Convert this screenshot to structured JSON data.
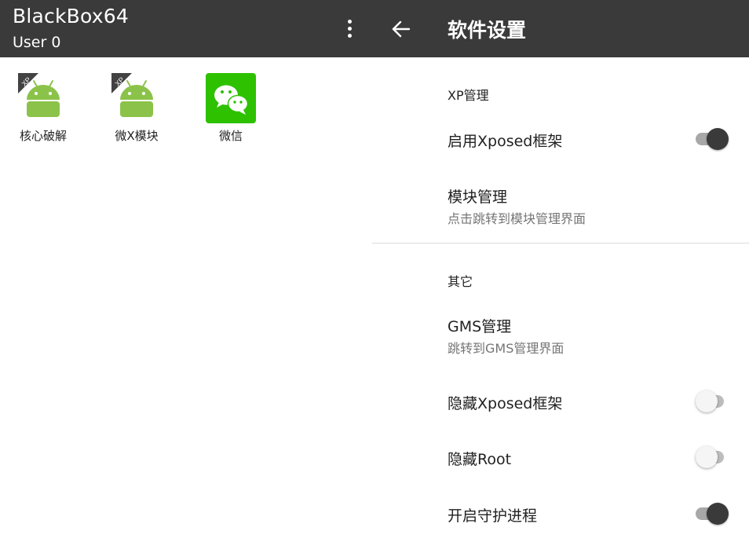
{
  "left": {
    "app_title": "BlackBox64",
    "user_label": "User 0",
    "apps": [
      {
        "label": "核心破解",
        "icon": "android-xp-icon",
        "badge": "XP"
      },
      {
        "label": "微X模块",
        "icon": "android-xp-icon",
        "badge": "XP"
      },
      {
        "label": "微信",
        "icon": "wechat-icon"
      }
    ]
  },
  "right": {
    "title": "软件设置",
    "categories": {
      "xp": "XP管理",
      "other": "其它"
    },
    "prefs": {
      "enable_xposed": {
        "title": "启用Xposed框架",
        "checked": true
      },
      "module_manage": {
        "title": "模块管理",
        "summary": "点击跳转到模块管理界面"
      },
      "gms_manage": {
        "title": "GMS管理",
        "summary": "跳转到GMS管理界面"
      },
      "hide_xposed": {
        "title": "隐藏Xposed框架",
        "checked": false
      },
      "hide_root": {
        "title": "隐藏Root",
        "checked": false
      },
      "daemon": {
        "title": "开启守护进程",
        "checked": true
      }
    }
  },
  "colors": {
    "appbar": "#3a3a3a",
    "android_green": "#8bc34a",
    "wechat_green": "#2dc100",
    "switch_on_thumb": "#3a3a3a",
    "switch_off_thumb": "#f5f5f5"
  }
}
